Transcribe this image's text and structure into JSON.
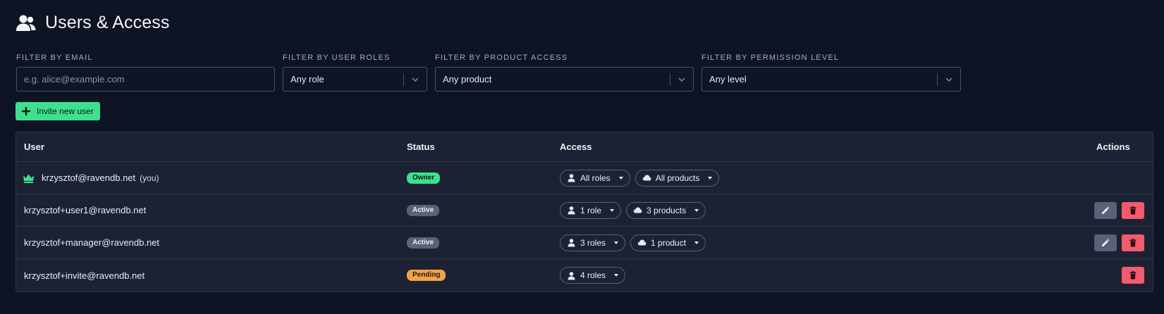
{
  "header": {
    "title": "Users & Access",
    "icon": "users-icon"
  },
  "filters": {
    "email": {
      "label": "FILTER BY EMAIL",
      "placeholder": "e.g. alice@example.com",
      "value": ""
    },
    "roles": {
      "label": "FILTER BY USER ROLES",
      "value": "Any role"
    },
    "product": {
      "label": "FILTER BY PRODUCT ACCESS",
      "value": "Any product"
    },
    "permission": {
      "label": "FILTER BY PERMISSION LEVEL",
      "value": "Any level"
    }
  },
  "invite_button": {
    "label": "Invite new user"
  },
  "table": {
    "headers": {
      "user": "User",
      "status": "Status",
      "access": "Access",
      "actions": "Actions"
    },
    "rows": [
      {
        "email": "krzysztof@ravendb.net",
        "you": "(you)",
        "status": "Owner",
        "roles": "All roles",
        "products": "All products"
      },
      {
        "email": "krzysztof+user1@ravendb.net",
        "status": "Active",
        "roles": "1 role",
        "products": "3 products"
      },
      {
        "email": "krzysztof+manager@ravendb.net",
        "status": "Active",
        "roles": "3 roles",
        "products": "1 product"
      },
      {
        "email": "krzysztof+invite@ravendb.net",
        "status": "Pending",
        "roles": "4 roles"
      }
    ]
  },
  "colors": {
    "background": "#0e1424",
    "table_bg": "#1c2233",
    "accent_green": "#3ee08f",
    "badge_active": "#5b6277",
    "badge_pending": "#f0a44a",
    "delete_red": "#f25a6e"
  }
}
